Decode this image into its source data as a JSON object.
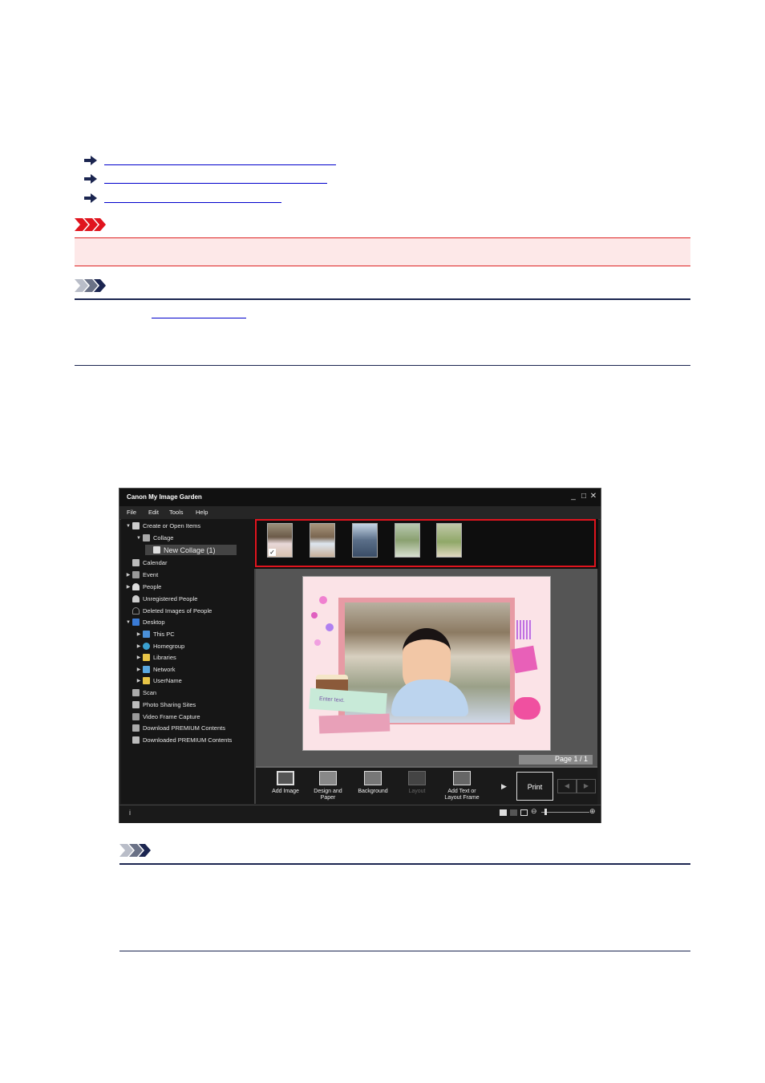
{
  "app": {
    "title": "Canon My Image Garden",
    "menu": [
      "File",
      "Edit",
      "Tools",
      "Help"
    ],
    "sidebar": {
      "items": [
        {
          "label": "Create or Open Items",
          "expand": "▼"
        },
        {
          "label": "Collage",
          "expand": "▼"
        },
        {
          "label": "New Collage (1)",
          "expand": ""
        },
        {
          "label": "Calendar",
          "expand": ""
        },
        {
          "label": "Event",
          "expand": "▶"
        },
        {
          "label": "People",
          "expand": "▶"
        },
        {
          "label": "Unregistered People",
          "expand": ""
        },
        {
          "label": "Deleted Images of People",
          "expand": ""
        },
        {
          "label": "Desktop",
          "expand": "▼"
        },
        {
          "label": "This PC",
          "expand": "▶"
        },
        {
          "label": "Homegroup",
          "expand": "▶"
        },
        {
          "label": "Libraries",
          "expand": "▶"
        },
        {
          "label": "Network",
          "expand": "▶"
        },
        {
          "label": "UserName",
          "expand": "▶"
        },
        {
          "label": "Scan",
          "expand": ""
        },
        {
          "label": "Photo Sharing Sites",
          "expand": ""
        },
        {
          "label": "Video Frame Capture",
          "expand": ""
        },
        {
          "label": "Download PREMIUM Contents",
          "expand": ""
        },
        {
          "label": "Downloaded PREMIUM Contents",
          "expand": ""
        }
      ]
    },
    "collage": {
      "text_placeholder": "Enter text.",
      "page_label": "Page 1 / 1"
    },
    "toolbar": {
      "add_image": "Add Image",
      "design_paper_1": "Design and",
      "design_paper_2": "Paper",
      "background": "Background",
      "layout": "Layout",
      "add_text_1": "Add Text or",
      "add_text_2": "Layout Frame",
      "print": "Print"
    },
    "status": {
      "info": "i"
    }
  },
  "colors": {
    "highlight": "#e0141e",
    "link": "#0000cc",
    "important_band": "#fde8e8",
    "note_rule": "#1b2550"
  },
  "icons": {
    "important": "important-chevrons-icon",
    "note": "note-chevrons-icon",
    "link_arrow": "right-arrow-icon"
  }
}
